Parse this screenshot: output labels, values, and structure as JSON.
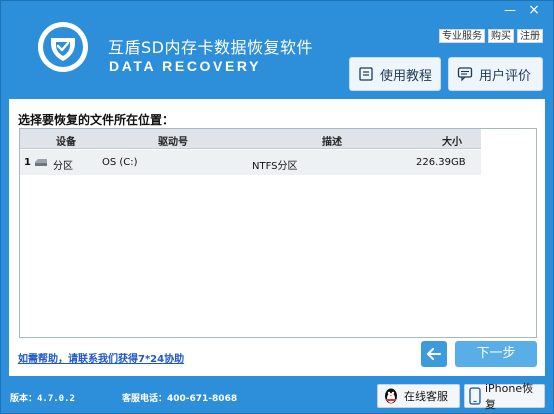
{
  "app": {
    "title": "互盾SD内存卡数据恢复软件",
    "subtitle": "DATA RECOVERY"
  },
  "window_controls": {
    "minimize": "—",
    "close": "×"
  },
  "top_links": [
    "专业服务",
    "购买",
    "注册"
  ],
  "actions": {
    "tutorial_label": "使用教程",
    "review_label": "用户评价"
  },
  "main": {
    "prompt": "选择要恢复的文件所在位置：",
    "table": {
      "columns": [
        "设备",
        "驱动号",
        "描述",
        "大小"
      ],
      "rows": [
        {
          "index": "1",
          "device": "分区",
          "drive": "OS (C:)",
          "description": "NTFS分区",
          "size": "226.39GB"
        }
      ]
    },
    "help_link": "如需帮助，请联系我们获得7*24协助",
    "next_label": "下一步"
  },
  "footer": {
    "version": "版本：4.7.0.2",
    "phone": "客服电话：400-671-8068",
    "online_service_label": "在线客服",
    "iphone_recovery_label": "iPhone恢复"
  },
  "colors": {
    "brand_blue": "#2d8fd9",
    "next_button": "#5aaee8",
    "link": "#1f56c9"
  }
}
